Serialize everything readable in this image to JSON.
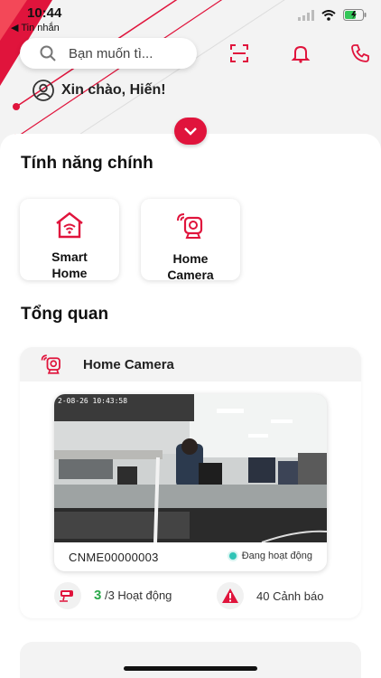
{
  "status_bar": {
    "time": "10:44",
    "back_app": "◀ Tin nhắn"
  },
  "search": {
    "placeholder": "Bạn muốn tì..."
  },
  "greeting": "Xin chào, Hiến!",
  "sections": {
    "main_features": "Tính năng chính",
    "overview": "Tổng quan"
  },
  "features": [
    {
      "label_line1": "Smart",
      "label_line2": "Home",
      "icon": "smart-home-icon"
    },
    {
      "label_line1": "Home",
      "label_line2": "Camera",
      "icon": "home-camera-icon"
    }
  ],
  "camera_section": {
    "title": "Home Camera",
    "feed_timestamp": "2-08-26 10:43:58",
    "camera_id": "CNME00000003",
    "camera_status": "Đang hoạt động",
    "active_count": "3",
    "active_suffix": "/3 Hoạt động",
    "warnings": "40 Cảnh báo"
  },
  "colors": {
    "accent": "#e0143c",
    "active": "#2aa84a",
    "online_dot": "#2ec4b6"
  }
}
